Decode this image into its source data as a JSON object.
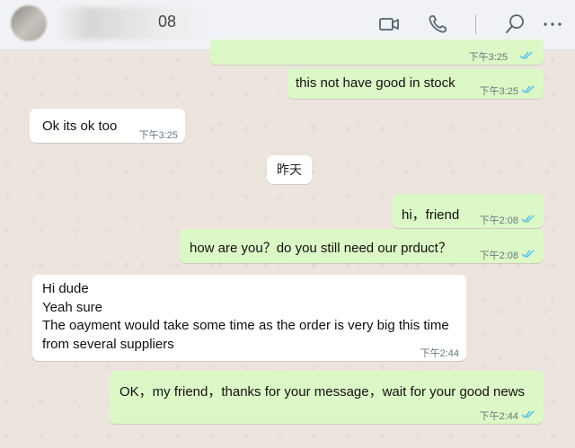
{
  "header": {
    "contact_name_visible": "08",
    "icons": [
      "video-call-icon",
      "voice-call-icon",
      "search-icon",
      "more-options-icon"
    ]
  },
  "messages": [
    {
      "direction": "outgoing",
      "text": "",
      "time": "下午3:25",
      "status": "read"
    },
    {
      "direction": "outgoing",
      "text": "this not have good in stock",
      "time": "下午3:25",
      "status": "read"
    },
    {
      "direction": "incoming",
      "text": "Ok its ok too",
      "time": "下午3:25"
    },
    {
      "direction": "outgoing",
      "text": "hi，friend",
      "time": "下午2:08",
      "status": "read"
    },
    {
      "direction": "outgoing",
      "text": "how are you？do you still need our prduct？",
      "time": "下午2:08",
      "status": "read"
    },
    {
      "direction": "incoming",
      "lines": [
        "Hi dude",
        "Yeah sure",
        "The oayment would take some time as the order is very big this time",
        "from several suppliers"
      ],
      "time": "下午2:44"
    },
    {
      "direction": "outgoing",
      "text": "OK，my friend，thanks for your message，wait for your good news",
      "time": "下午2:44",
      "status": "read"
    }
  ],
  "date_separator": "昨天",
  "colors": {
    "outgoing_bubble": "#dcf8c6",
    "incoming_bubble": "#ffffff",
    "read_ticks": "#53bdeb",
    "chat_background": "#ece5dd"
  }
}
